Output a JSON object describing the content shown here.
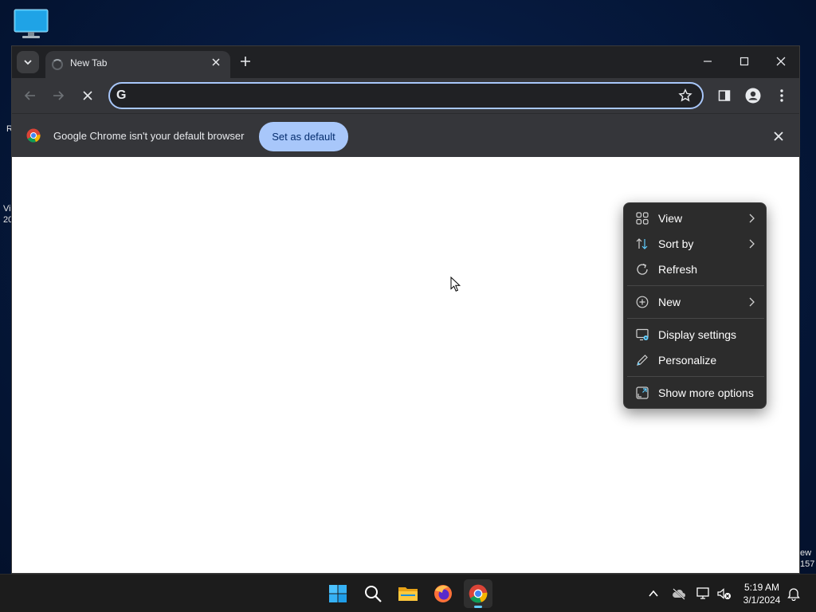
{
  "browser": {
    "tab": {
      "title": "New Tab"
    },
    "omnibox": {
      "value": "",
      "placeholder": ""
    },
    "infobar": {
      "message": "Google Chrome isn't your default browser",
      "button_label": "Set as default"
    }
  },
  "context_menu": {
    "items": [
      {
        "label": "View",
        "icon": "grid-icon",
        "submenu": true
      },
      {
        "label": "Sort by",
        "icon": "sort-arrows-icon",
        "submenu": true
      },
      {
        "label": "Refresh",
        "icon": "refresh-icon",
        "submenu": false
      },
      {
        "label": "New",
        "icon": "plus-circle-icon",
        "submenu": true
      },
      {
        "label": "Display settings",
        "icon": "display-settings-icon",
        "submenu": false
      },
      {
        "label": "Personalize",
        "icon": "pen-icon",
        "submenu": false
      },
      {
        "label": "Show more options",
        "icon": "expand-icon",
        "submenu": false
      }
    ]
  },
  "desktop_edge_text": {
    "left_1": "R",
    "left_2": "Vi",
    "left_3": "20",
    "right_1": "ew",
    "right_2": "157"
  },
  "taskbar": {
    "apps": [
      "windows-start",
      "search",
      "file-explorer",
      "firefox",
      "chrome"
    ],
    "active_app": "chrome",
    "clock": {
      "time": "5:19 AM",
      "date": "3/1/2024"
    }
  },
  "colors": {
    "accent": "#a8c7fa",
    "chrome_frame": "#202124",
    "chrome_toolbar": "#35363a",
    "menu_bg": "#2c2c2c",
    "taskbar_bg": "#1c1c1c",
    "active_indicator": "#60cdff"
  }
}
